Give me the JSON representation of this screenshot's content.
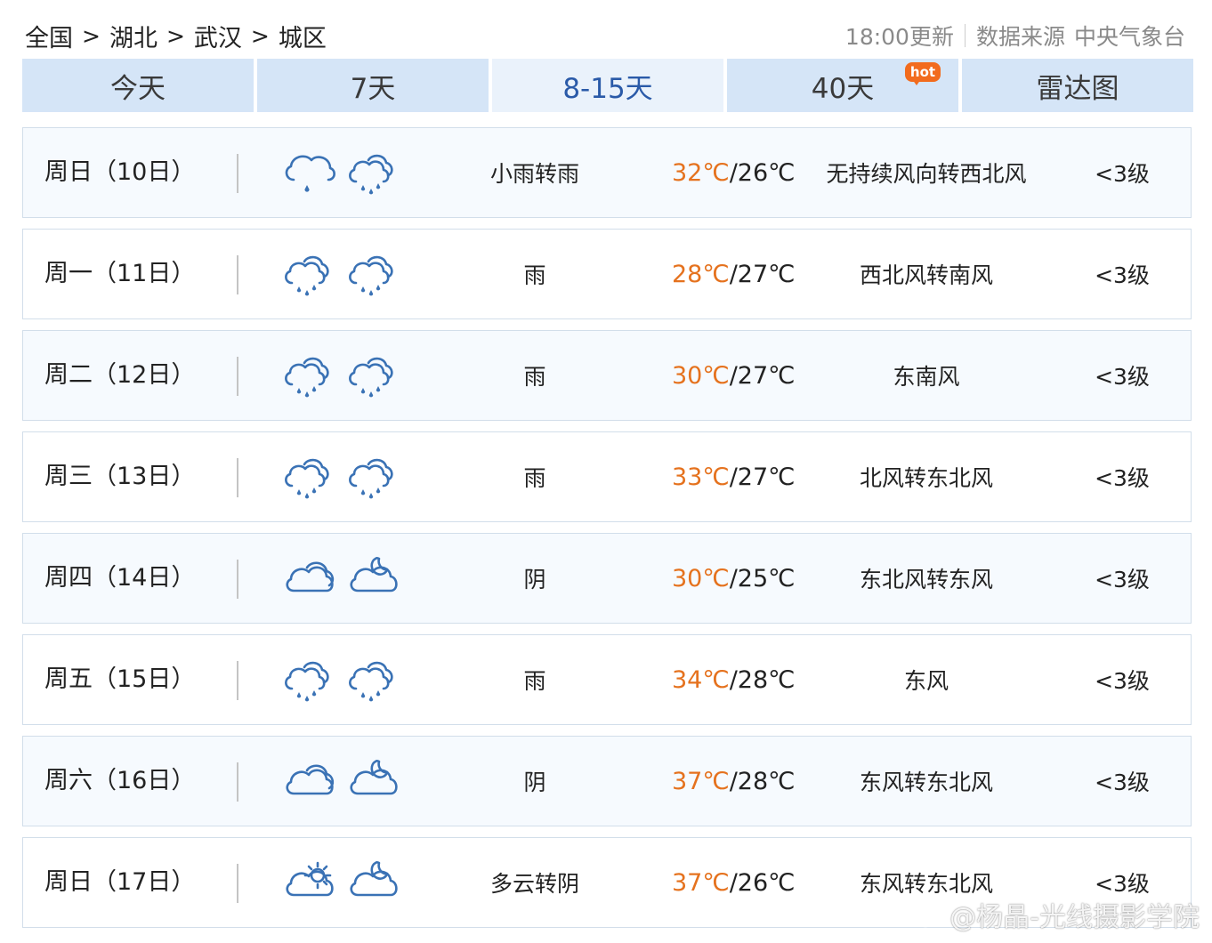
{
  "breadcrumb": {
    "items": [
      "全国",
      "湖北",
      "武汉",
      "城区"
    ],
    "separator": ">"
  },
  "update": {
    "time_label": "18:00更新",
    "source_label": "数据来源",
    "source_name": "中央气象台"
  },
  "tabs": [
    {
      "label": "今天",
      "active": false
    },
    {
      "label": "7天",
      "active": false
    },
    {
      "label": "8-15天",
      "active": true
    },
    {
      "label": "40天",
      "active": false,
      "badge": "hot"
    },
    {
      "label": "雷达图",
      "active": false
    }
  ],
  "forecast": [
    {
      "day": "周日（10日）",
      "day_icon": "light-rain-icon",
      "night_icon": "rain-icon",
      "weather": "小雨转雨",
      "high": "32℃",
      "low": "26℃",
      "wind": "无持续风向转西北风",
      "level": "<3级"
    },
    {
      "day": "周一（11日）",
      "day_icon": "rain-icon",
      "night_icon": "rain-icon",
      "weather": "雨",
      "high": "28℃",
      "low": "27℃",
      "wind": "西北风转南风",
      "level": "<3级"
    },
    {
      "day": "周二（12日）",
      "day_icon": "rain-icon",
      "night_icon": "rain-icon",
      "weather": "雨",
      "high": "30℃",
      "low": "27℃",
      "wind": "东南风",
      "level": "<3级"
    },
    {
      "day": "周三（13日）",
      "day_icon": "rain-icon",
      "night_icon": "rain-icon",
      "weather": "雨",
      "high": "33℃",
      "low": "27℃",
      "wind": "北风转东北风",
      "level": "<3级"
    },
    {
      "day": "周四（14日）",
      "day_icon": "overcast-icon",
      "night_icon": "cloudy-night-icon",
      "weather": "阴",
      "high": "30℃",
      "low": "25℃",
      "wind": "东北风转东风",
      "level": "<3级"
    },
    {
      "day": "周五（15日）",
      "day_icon": "rain-icon",
      "night_icon": "rain-icon",
      "weather": "雨",
      "high": "34℃",
      "low": "28℃",
      "wind": "东风",
      "level": "<3级"
    },
    {
      "day": "周六（16日）",
      "day_icon": "overcast-icon",
      "night_icon": "cloudy-night-icon",
      "weather": "阴",
      "high": "37℃",
      "low": "28℃",
      "wind": "东风转东北风",
      "level": "<3级"
    },
    {
      "day": "周日（17日）",
      "day_icon": "partly-cloudy-day-icon",
      "night_icon": "cloudy-night-icon",
      "weather": "多云转阴",
      "high": "37℃",
      "low": "26℃",
      "wind": "东风转东北风",
      "level": "<3级"
    }
  ],
  "colors": {
    "accent": "#2a5aa8",
    "high_temp": "#e5721e",
    "tab_bg": "#d5e5f7",
    "hot_badge": "#f26b1d",
    "icon": "#3a72b5"
  },
  "watermark": {
    "text": "@杨晶-光线摄影学院"
  }
}
